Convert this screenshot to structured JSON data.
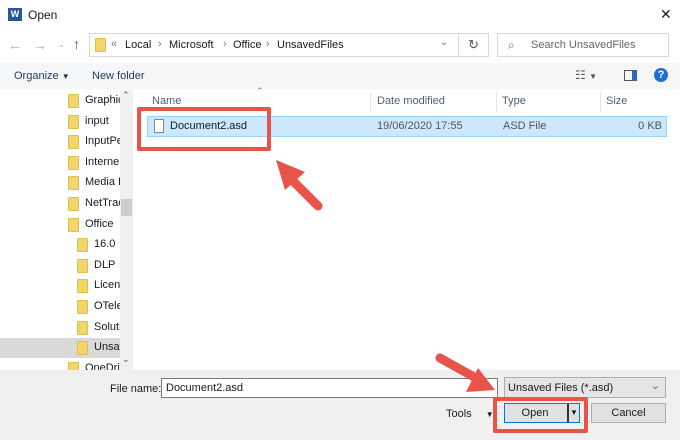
{
  "window": {
    "title": "Open",
    "close": "✕"
  },
  "nav": {
    "back": "←",
    "forward": "→",
    "up": "↑",
    "breadcrumb": [
      "Local",
      "Microsoft",
      "Office",
      "UnsavedFiles"
    ],
    "overflow": "«",
    "search_placeholder": "Search UnsavedFiles"
  },
  "toolbar": {
    "organize": "Organize",
    "new_folder": "New folder",
    "help": "?"
  },
  "sidebar": {
    "items": [
      {
        "label": "Graphic",
        "level": 1
      },
      {
        "label": "input",
        "level": 1
      },
      {
        "label": "InputPe",
        "level": 1
      },
      {
        "label": "Interne",
        "level": 1
      },
      {
        "label": "Media I",
        "level": 1
      },
      {
        "label": "NetTrac",
        "level": 1
      },
      {
        "label": "Office",
        "level": 1
      },
      {
        "label": "16.0",
        "level": 2
      },
      {
        "label": "DLP",
        "level": 2
      },
      {
        "label": "Licens",
        "level": 2
      },
      {
        "label": "OTele",
        "level": 2
      },
      {
        "label": "Soluti",
        "level": 2
      },
      {
        "label": "Unsav",
        "level": 2,
        "selected": true
      },
      {
        "label": "OneDri",
        "level": 1
      }
    ]
  },
  "columns": {
    "name": "Name",
    "date": "Date modified",
    "type": "Type",
    "size": "Size"
  },
  "files": [
    {
      "name": "Document2.asd",
      "date": "19/06/2020 17:55",
      "type": "ASD File",
      "size": "0 KB",
      "selected": true
    }
  ],
  "footer": {
    "file_name_label": "File name:",
    "file_name_value": "Document2.asd",
    "filter": "Unsaved Files (*.asd)",
    "tools": "Tools",
    "open": "Open",
    "cancel": "Cancel"
  },
  "colors": {
    "annotation": "#e8534a",
    "selection": "#cce8ff",
    "accent": "#0078d7"
  }
}
